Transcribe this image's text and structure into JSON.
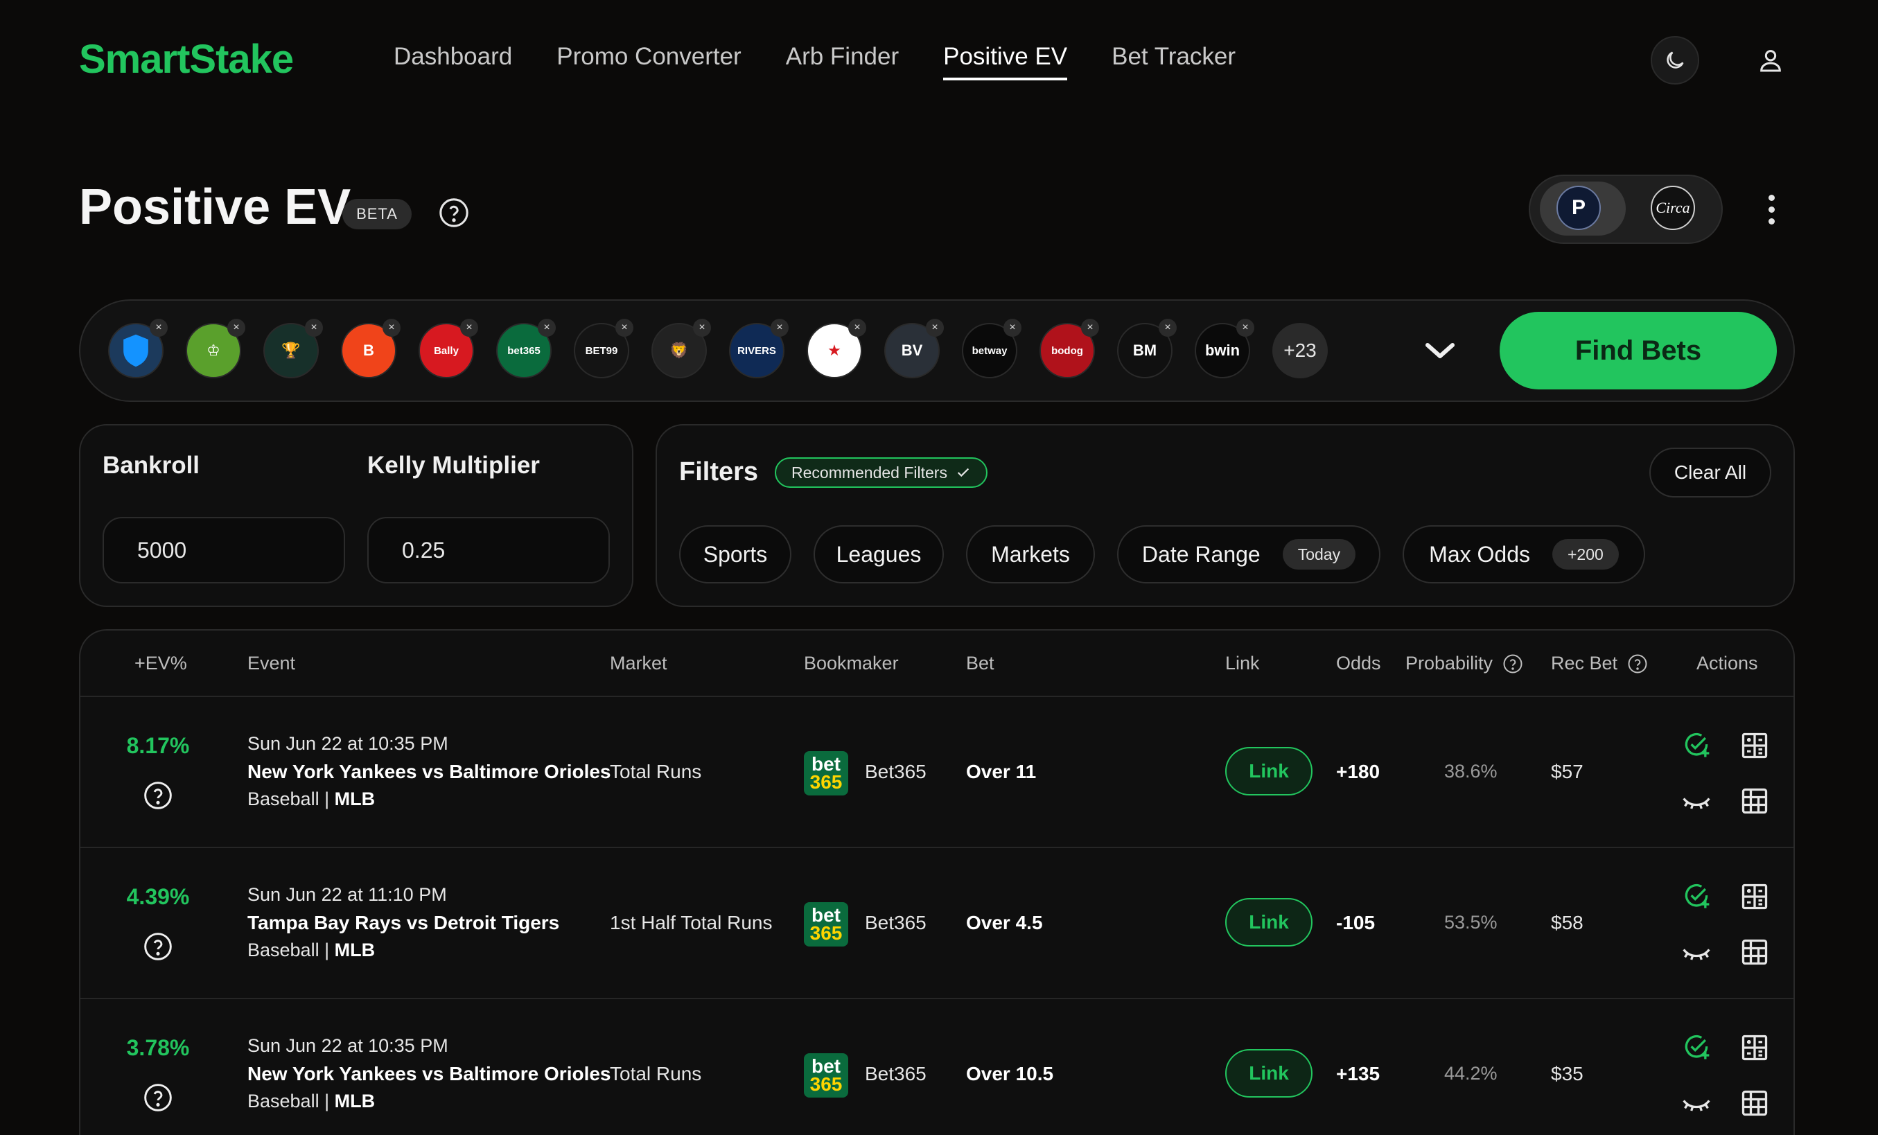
{
  "brand": "SmartStake",
  "nav": [
    "Dashboard",
    "Promo Converter",
    "Arb Finder",
    "Positive EV",
    "Bet Tracker"
  ],
  "page": {
    "title": "Positive EV",
    "badge": "BETA"
  },
  "toggle": {
    "p_label": "P",
    "circa_label": "Circa"
  },
  "books": [
    {
      "name": "fanduel-logo",
      "label": "",
      "bg": "#1c3a5c"
    },
    {
      "name": "draftkings-logo",
      "label": "♔",
      "bg": "#5aa02c"
    },
    {
      "name": "trophy-logo",
      "label": "🏆",
      "bg": "#17302a"
    },
    {
      "name": "b-logo",
      "label": "B",
      "bg": "#f0441a"
    },
    {
      "name": "bally-logo",
      "label": "Bally",
      "bg": "#d71920"
    },
    {
      "name": "bet365-logo",
      "label": "bet365",
      "bg": "#0a6b3d"
    },
    {
      "name": "bet99-logo",
      "label": "BET99",
      "bg": "#141414"
    },
    {
      "name": "lion-logo",
      "label": "🦁",
      "bg": "#222"
    },
    {
      "name": "betrivers-logo",
      "label": "RIVERS",
      "bg": "#0f2a55"
    },
    {
      "name": "star-logo",
      "label": "★",
      "bg": "#ffffff"
    },
    {
      "name": "bv-logo",
      "label": "BV",
      "bg": "#2a3038"
    },
    {
      "name": "betway-logo",
      "label": "betway",
      "bg": "#0a0a0a"
    },
    {
      "name": "bodog-logo",
      "label": "bodog",
      "bg": "#b0121b"
    },
    {
      "name": "bm-logo",
      "label": "BM",
      "bg": "#101010"
    },
    {
      "name": "bwin-logo",
      "label": "bwin",
      "bg": "#0a0a0a"
    }
  ],
  "more_books": "+23",
  "find_bets": "Find Bets",
  "bankroll": {
    "label": "Bankroll",
    "value": "5000"
  },
  "kelly": {
    "label": "Kelly Multiplier",
    "value": "0.25"
  },
  "filters": {
    "title": "Filters",
    "recommended": "Recommended Filters",
    "clear_all": "Clear All",
    "sports": "Sports",
    "leagues": "Leagues",
    "markets": "Markets",
    "date_range": "Date Range",
    "date_value": "Today",
    "max_odds": "Max Odds",
    "max_odds_value": "+200"
  },
  "table": {
    "headers": {
      "ev": "+EV%",
      "event": "Event",
      "market": "Market",
      "bookmaker": "Bookmaker",
      "bet": "Bet",
      "link": "Link",
      "odds": "Odds",
      "probability": "Probability",
      "rec_bet": "Rec Bet",
      "actions": "Actions"
    },
    "rows": [
      {
        "ev": "8.17%",
        "date": "Sun Jun 22 at 10:35 PM",
        "event": "New York Yankees vs Baltimore Orioles",
        "sport": "Baseball | ",
        "league": "MLB",
        "market": "Total Runs",
        "book": "Bet365",
        "bet": "Over 11",
        "link": "Link",
        "odds": "+180",
        "prob": "38.6%",
        "rec": "$57"
      },
      {
        "ev": "4.39%",
        "date": "Sun Jun 22 at 11:10 PM",
        "event": "Tampa Bay Rays vs Detroit Tigers",
        "sport": "Baseball | ",
        "league": "MLB",
        "market": "1st Half Total Runs",
        "book": "Bet365",
        "bet": "Over 4.5",
        "link": "Link",
        "odds": "-105",
        "prob": "53.5%",
        "rec": "$58"
      },
      {
        "ev": "3.78%",
        "date": "Sun Jun 22 at 10:35 PM",
        "event": "New York Yankees vs Baltimore Orioles",
        "sport": "Baseball | ",
        "league": "MLB",
        "market": "Total Runs",
        "book": "Bet365",
        "bet": "Over 10.5",
        "link": "Link",
        "odds": "+135",
        "prob": "44.2%",
        "rec": "$35"
      }
    ]
  },
  "colors": {
    "accent": "#22c55e",
    "bg": "#0b0a09"
  }
}
